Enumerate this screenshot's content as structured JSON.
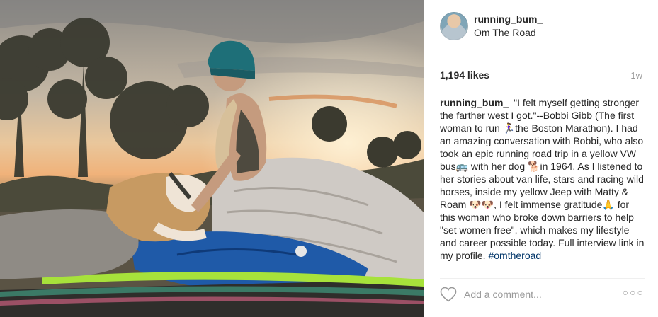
{
  "post": {
    "photo_alt": "",
    "header": {
      "username": "running_bum_",
      "location": "Om The Road"
    },
    "likes": "1,194 likes",
    "time": "1w",
    "caption": {
      "username": "running_bum_",
      "text": "\"I felt myself getting stronger the farther west I got.\"--Bobbi Gibb (The first woman to run 🏃‍♀️the Boston Marathon). I had an amazing conversation with Bobbi, who also took an epic running road trip in a yellow VW bus🚌 with her dog 🐕in 1964. As I listened to her stories about van life, stars and racing wild horses, inside my yellow Jeep with Matty & Roam 🐶🐶, I felt immense gratitude🙏 for this woman who broke down barriers to help \"set women free\", which makes my lifestyle and career possible today. Full interview link in my profile. ",
      "hashtag": "#omtheroad"
    },
    "comment_placeholder": "Add a comment...",
    "icons": {
      "like": "heart-outline-icon",
      "more": "more-options-icon"
    }
  }
}
